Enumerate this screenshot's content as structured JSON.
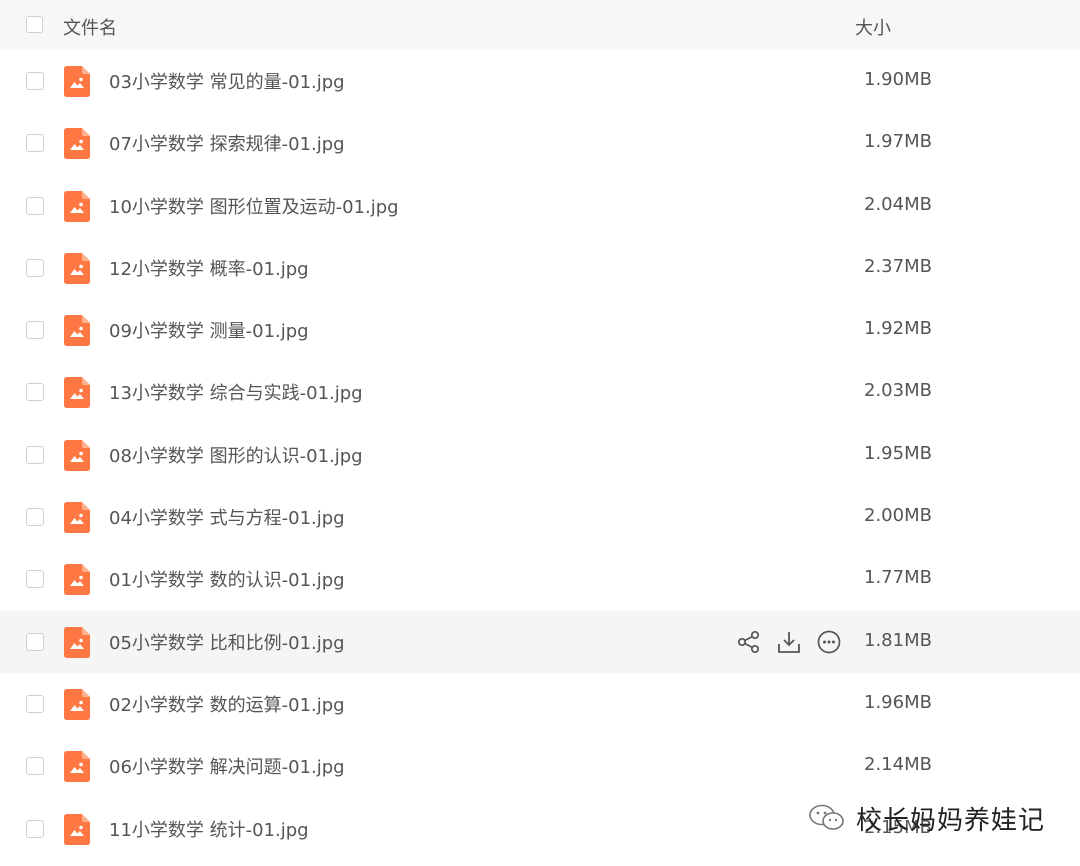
{
  "header": {
    "name_label": "文件名",
    "size_label": "大小"
  },
  "files": [
    {
      "name": "03小学数学 常见的量-01.jpg",
      "size": "1.90MB"
    },
    {
      "name": "07小学数学 探索规律-01.jpg",
      "size": "1.97MB"
    },
    {
      "name": "10小学数学 图形位置及运动-01.jpg",
      "size": "2.04MB"
    },
    {
      "name": "12小学数学 概率-01.jpg",
      "size": "2.37MB"
    },
    {
      "name": "09小学数学 测量-01.jpg",
      "size": "1.92MB"
    },
    {
      "name": "13小学数学 综合与实践-01.jpg",
      "size": "2.03MB"
    },
    {
      "name": "08小学数学 图形的认识-01.jpg",
      "size": "1.95MB"
    },
    {
      "name": "04小学数学 式与方程-01.jpg",
      "size": "2.00MB"
    },
    {
      "name": "01小学数学 数的认识-01.jpg",
      "size": "1.77MB"
    },
    {
      "name": "05小学数学 比和比例-01.jpg",
      "size": "1.81MB"
    },
    {
      "name": "02小学数学 数的运算-01.jpg",
      "size": "1.96MB"
    },
    {
      "name": "06小学数学 解决问题-01.jpg",
      "size": "2.14MB"
    },
    {
      "name": "11小学数学 统计-01.jpg",
      "size": "2.15MB"
    }
  ],
  "hovered_row_index": 9,
  "row_actions": [
    "share-icon",
    "download-icon",
    "more-icon"
  ],
  "watermark": {
    "text": "校长妈妈养娃记",
    "icon": "wechat-icon"
  },
  "colors": {
    "file_icon": "#ff7743",
    "hover_bg": "#f5f5f6",
    "header_bg": "#f6f7f9"
  }
}
